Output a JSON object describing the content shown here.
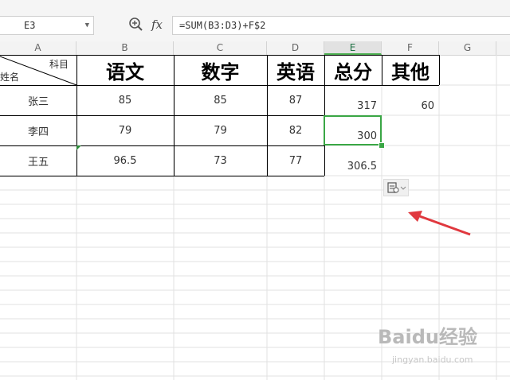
{
  "formula_bar": {
    "cell_ref": "E3",
    "formula": "=SUM(B3:D3)+F$2"
  },
  "columns": [
    "A",
    "B",
    "C",
    "D",
    "E",
    "F",
    "G"
  ],
  "table": {
    "header_diag_top": "科目",
    "header_diag_bottom": "姓名",
    "headers": [
      "语文",
      "数字",
      "英语",
      "总分",
      "其他"
    ],
    "rows": [
      {
        "name": "张三",
        "b": "85",
        "c": "85",
        "d": "87",
        "e": "317",
        "f": "60"
      },
      {
        "name": "李四",
        "b": "79",
        "c": "79",
        "d": "82",
        "e": "300",
        "f": ""
      },
      {
        "name": "王五",
        "b": "96.5",
        "c": "73",
        "d": "77",
        "e": "306.5",
        "f": ""
      }
    ]
  },
  "watermark": {
    "text": "Baidu经验",
    "sub": "jingyan.baidu.com"
  },
  "colors": {
    "selection": "#3aa745",
    "arrow": "#e0383e"
  }
}
